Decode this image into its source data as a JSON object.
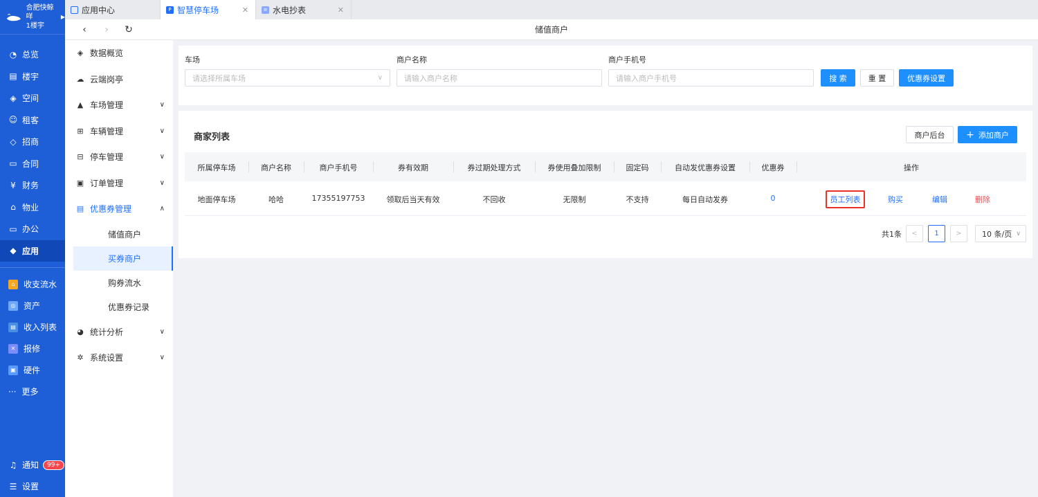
{
  "brand": {
    "org": "合肥快鲸咩",
    "building": "1楼宇"
  },
  "rail": {
    "items": [
      {
        "label": "总览",
        "icon": "dashboard-icon"
      },
      {
        "label": "楼宇",
        "icon": "building-icon"
      },
      {
        "label": "空间",
        "icon": "cube-icon"
      },
      {
        "label": "租客",
        "icon": "people-icon"
      },
      {
        "label": "招商",
        "icon": "tag-icon"
      },
      {
        "label": "合同",
        "icon": "document-icon"
      },
      {
        "label": "财务",
        "icon": "currency-icon"
      },
      {
        "label": "物业",
        "icon": "house-icon"
      },
      {
        "label": "办公",
        "icon": "monitor-icon"
      },
      {
        "label": "应用",
        "icon": "app-icon"
      }
    ],
    "apps": [
      {
        "label": "收支流水",
        "color": "#f5a623"
      },
      {
        "label": "资产",
        "color": "#6ea8ff"
      },
      {
        "label": "收入列表",
        "color": "#4a90e2"
      },
      {
        "label": "报修",
        "color": "#7b8cff"
      },
      {
        "label": "硬件",
        "color": "#5b9bff"
      }
    ],
    "more": "更多",
    "notify": "通知",
    "notify_badge": "99+",
    "settings": "设置"
  },
  "tabs": [
    {
      "label": "应用中心"
    },
    {
      "label": "智慧停车场"
    },
    {
      "label": "水电抄表"
    }
  ],
  "page_title": "储值商户",
  "side": {
    "items": [
      {
        "label": "数据概览"
      },
      {
        "label": "云端岗亭"
      },
      {
        "label": "车场管理"
      },
      {
        "label": "车辆管理"
      },
      {
        "label": "停车管理"
      },
      {
        "label": "订单管理"
      },
      {
        "label": "优惠券管理"
      },
      {
        "label": "统计分析"
      },
      {
        "label": "系统设置"
      }
    ],
    "subs": [
      {
        "label": "储值商户"
      },
      {
        "label": "买券商户"
      },
      {
        "label": "购券流水"
      },
      {
        "label": "优惠券记录"
      }
    ]
  },
  "filter": {
    "lot_label": "车场",
    "lot_placeholder": "请选择所属车场",
    "name_label": "商户名称",
    "name_placeholder": "请输入商户名称",
    "phone_label": "商户手机号",
    "phone_placeholder": "请输入商户手机号",
    "search": "搜 索",
    "reset": "重 置",
    "coupon_settings": "优惠券设置"
  },
  "list": {
    "title": "商家列表",
    "backend_btn": "商户后台",
    "add_btn": "添加商户",
    "headers": [
      "所属停车场",
      "商户名称",
      "商户手机号",
      "券有效期",
      "券过期处理方式",
      "券使用叠加限制",
      "固定码",
      "自动发优惠券设置",
      "优惠券",
      "操作"
    ],
    "rows": [
      {
        "lot": "地面停车场",
        "name": "哈哈",
        "phone": "17355197753",
        "validity": "领取后当天有效",
        "expire": "不回收",
        "stack": "无限制",
        "fixed_code": "不支持",
        "auto": "每日自动发券",
        "coupons": "0",
        "actions": [
          "员工列表",
          "购买",
          "编辑",
          "删除"
        ]
      }
    ],
    "pager": {
      "total": "共1条",
      "page": "1",
      "size": "10 条/页"
    }
  }
}
